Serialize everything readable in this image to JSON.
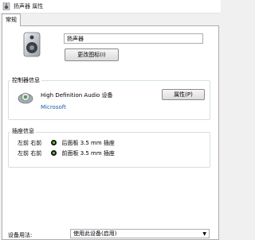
{
  "window": {
    "title": "扬声器 属性"
  },
  "tabs": [
    {
      "label": "常规"
    }
  ],
  "device": {
    "name_value": "扬声器",
    "change_icon_label": "更改图标(I)"
  },
  "controller": {
    "group_label": "控制器信息",
    "name": "High Definition Audio 设备",
    "vendor": "Microsoft",
    "properties_label": "属性(P)"
  },
  "jack": {
    "group_label": "插座信息",
    "rows": [
      {
        "side": "左前 右前",
        "desc": "后面板 3.5 mm 插座"
      },
      {
        "side": "左前 右前",
        "desc": "前面板 3.5 mm 插座"
      }
    ]
  },
  "usage": {
    "label": "设备用法:",
    "selected": "使用此设备(启用)"
  },
  "colors": {
    "link": "#1a5aa9",
    "jack_green": "#5ac33a"
  }
}
